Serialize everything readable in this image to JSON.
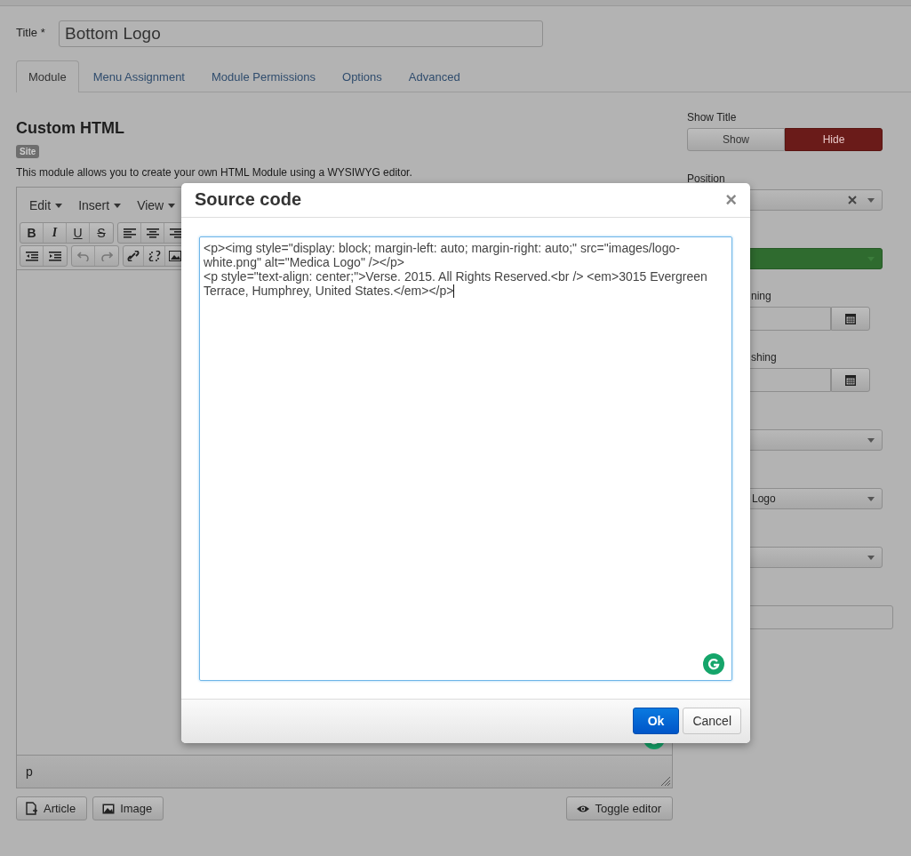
{
  "title_field": {
    "label": "Title *",
    "value": "Bottom Logo"
  },
  "tabs": [
    {
      "label": "Module",
      "selected": true
    },
    {
      "label": "Menu Assignment",
      "selected": false
    },
    {
      "label": "Module Permissions",
      "selected": false
    },
    {
      "label": "Options",
      "selected": false
    },
    {
      "label": "Advanced",
      "selected": false
    }
  ],
  "module": {
    "heading": "Custom HTML",
    "badge": "Site",
    "description": "This module allows you to create your own HTML Module using a WYSIWYG editor."
  },
  "editor": {
    "menus": [
      "Edit",
      "Insert",
      "View"
    ],
    "format_buttons": [
      "B",
      "I",
      "U",
      "S"
    ],
    "path": "p"
  },
  "editor_buttons": [
    {
      "kind": "article",
      "label": "Article"
    },
    {
      "kind": "image",
      "label": "Image"
    },
    {
      "kind": "toggle",
      "label": "Toggle editor"
    }
  ],
  "sidebar": {
    "show_title": {
      "label": "Show Title",
      "options": [
        {
          "label": "Show",
          "selected": false
        },
        {
          "label": "Hide",
          "selected": true
        }
      ]
    },
    "fields": [
      {
        "kind": "select",
        "label": "Position",
        "clearable": true
      },
      {
        "kind": "status"
      },
      {
        "kind": "date",
        "label": "ning"
      },
      {
        "kind": "date",
        "label": "shing"
      },
      {
        "kind": "select"
      },
      {
        "kind": "select",
        "value": "Logo"
      },
      {
        "kind": "select"
      },
      {
        "kind": "input"
      }
    ]
  },
  "dialog": {
    "title": "Source code",
    "close": "×",
    "source_lines": [
      "<p><img style=\"display: block; margin-left: auto; margin-right: auto;\" src=\"images/logo-white.png\" alt=\"Medica Logo\" /></p>",
      "<p style=\"text-align: center;\">Verse. 2015. All Rights Reserved.<br /> <em>3015 Evergreen Terrace, Humphrey, United States.</em></p>"
    ],
    "buttons": [
      {
        "label": "Ok",
        "primary": true
      },
      {
        "label": "Cancel",
        "primary": false
      }
    ]
  }
}
